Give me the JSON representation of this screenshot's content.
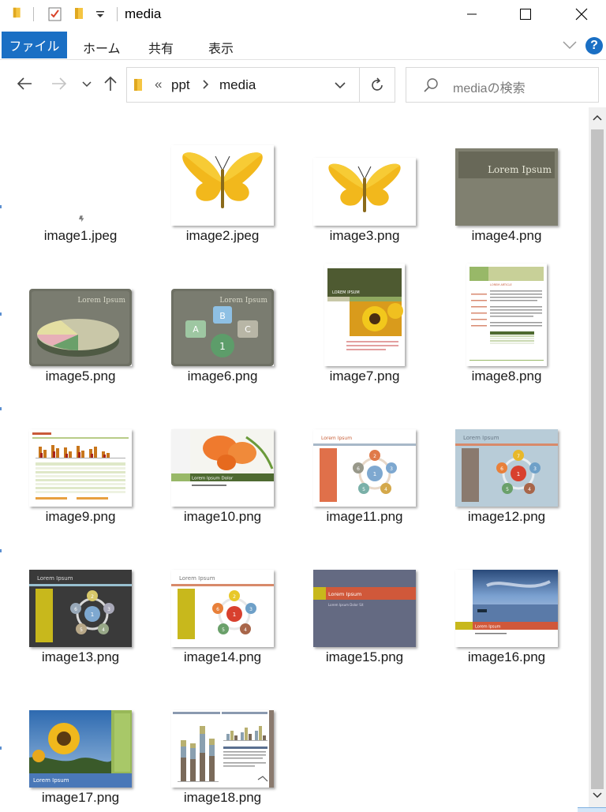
{
  "window": {
    "title": "media"
  },
  "ribbon": {
    "tabs": [
      "ファイル",
      "ホーム",
      "共有",
      "表示"
    ],
    "help_label": "?"
  },
  "address": {
    "overflow": "«",
    "segments": [
      "ppt",
      "media"
    ]
  },
  "search": {
    "placeholder": "mediaの検索"
  },
  "files": [
    {
      "name": "image1.jpeg"
    },
    {
      "name": "image2.jpeg"
    },
    {
      "name": "image3.png"
    },
    {
      "name": "image4.png"
    },
    {
      "name": "image5.png"
    },
    {
      "name": "image6.png"
    },
    {
      "name": "image7.png"
    },
    {
      "name": "image8.png"
    },
    {
      "name": "image9.png"
    },
    {
      "name": "image10.png"
    },
    {
      "name": "image11.png"
    },
    {
      "name": "image12.png"
    },
    {
      "name": "image13.png"
    },
    {
      "name": "image14.png"
    },
    {
      "name": "image15.png"
    },
    {
      "name": "image16.png"
    },
    {
      "name": "image17.png"
    },
    {
      "name": "image18.png"
    }
  ],
  "thumb_text": {
    "lorem": "Lorem Ipsum",
    "lorem_caps": "LOREM IPSUM",
    "lorem_dolor": "Lorem Ipsum Dolor",
    "lorem_dolor_sit": "Lorem Ipsum Dolor Sit",
    "lorem_article": "LOREM ARTICLE",
    "smart_a": "A",
    "smart_b": "B",
    "smart_c": "C",
    "smart_1": "1",
    "smart_2": "2",
    "smart_3": "3",
    "smart_4": "4",
    "smart_5": "5",
    "smart_6": "6",
    "smart_7": "7"
  },
  "colors": {
    "accent": "#1a6fc4",
    "selection_hint": "#d4e6f8"
  }
}
